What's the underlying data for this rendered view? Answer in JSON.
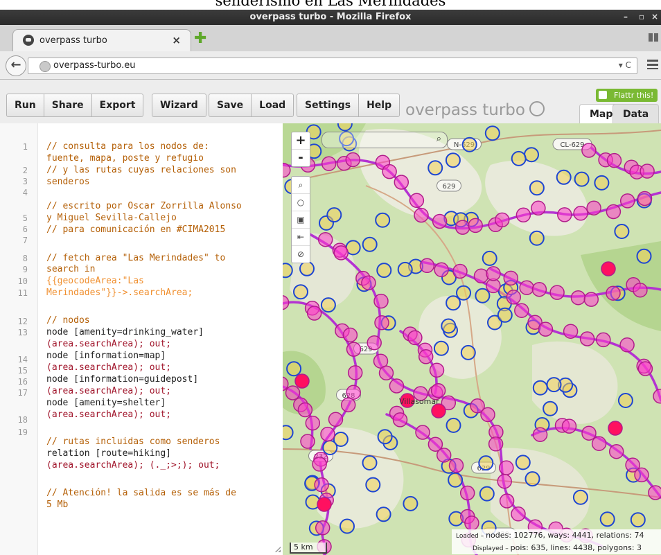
{
  "caption": "senderismo en Las Merindades",
  "window": {
    "title": "overpass turbo - Mozilla Firefox",
    "controls": [
      "–",
      "▫",
      "×"
    ]
  },
  "browser": {
    "tab_label": "overpass turbo",
    "tab_close": "×",
    "new_tab": "✚",
    "url": "overpass-turbo.eu"
  },
  "toolbar": {
    "group1": [
      "Run",
      "Share",
      "Export"
    ],
    "group2": [
      "Wizard"
    ],
    "group3": [
      "Save",
      "Load"
    ],
    "group4": [
      "Settings",
      "Help"
    ],
    "brand": "overpass turbo",
    "flattr": "Flattr this!",
    "tabs": {
      "map": "Map",
      "data": "Data"
    }
  },
  "editor": {
    "line_numbers": [
      "1",
      "2",
      "3",
      "4",
      "5",
      "6",
      "7",
      "8",
      "9",
      "10",
      "11",
      "12",
      "13",
      "14",
      "15",
      "16",
      "17",
      "18",
      "19"
    ],
    "lines": [
      {
        "t": "// consulta para los nodos de:",
        "c": "cm"
      },
      {
        "t": "fuente, mapa, poste y refugio",
        "c": "cm"
      },
      {
        "t": "// y las rutas cuyas relaciones son",
        "c": "cm"
      },
      {
        "t": "senderos",
        "c": "cm"
      },
      {
        "t": "// escrito por Oscar Zorrilla Alonso",
        "c": "cm"
      },
      {
        "t": "y Miguel Sevilla-Callejo",
        "c": "cm"
      },
      {
        "t": "// para comunicación en #CIMA2015",
        "c": "cm"
      },
      {
        "t": "// fetch area \"Las Merindades\" to",
        "c": "cm"
      },
      {
        "t": "search in",
        "c": "cm"
      },
      {
        "t": "{{geocodeArea:\"Las",
        "c": "br"
      },
      {
        "t": "Merindades\"}}->.searchArea;",
        "c": "br"
      },
      {
        "t": "// nodos",
        "c": "cm"
      },
      {
        "t": "node [amenity=drinking_water]",
        "c": "kw"
      },
      {
        "t": "(area.searchArea); out;",
        "c": "ar"
      },
      {
        "t": "node [information=map]",
        "c": "kw"
      },
      {
        "t": "(area.searchArea); out;",
        "c": "ar"
      },
      {
        "t": "node [information=guidepost]",
        "c": "kw"
      },
      {
        "t": "(area.searchArea); out;",
        "c": "ar"
      },
      {
        "t": "node [amenity=shelter]",
        "c": "kw"
      },
      {
        "t": "(area.searchArea); out;",
        "c": "ar"
      },
      {
        "t": "// rutas incluidas como senderos",
        "c": "cm"
      },
      {
        "t": "relation [route=hiking]",
        "c": "kw"
      },
      {
        "t": "(area.searchArea); (._;>;); out;",
        "c": "ar"
      },
      {
        "t": "// Atención! la salida es se más de",
        "c": "cm"
      },
      {
        "t": "5 Mb",
        "c": "cm"
      }
    ]
  },
  "map": {
    "zoom_in": "+",
    "zoom_out": "-",
    "tools": [
      "⌕",
      "○",
      "▣",
      "⇤",
      "⊘"
    ],
    "search_icon": "⌕",
    "scale": "5 km",
    "road_labels": [
      "N-629",
      "CL-629",
      "629",
      "629",
      "628",
      "629",
      "232",
      "N-629"
    ],
    "place_label": "Villasomar",
    "stats": {
      "loaded_prefix": "Loaded – ",
      "loaded": "nodes: 102776, ways: 4441, relations: 74",
      "displayed_prefix": "Displayed – ",
      "displayed": "pois: 635, lines: 4438, polygons: 3"
    },
    "colors": {
      "poi_fill": "#ff3ccc",
      "poi_stroke": "#b01c8a",
      "route": "#b432d2",
      "node_stroke": "#1e46d2",
      "node_fill": "#f0d25a"
    }
  }
}
